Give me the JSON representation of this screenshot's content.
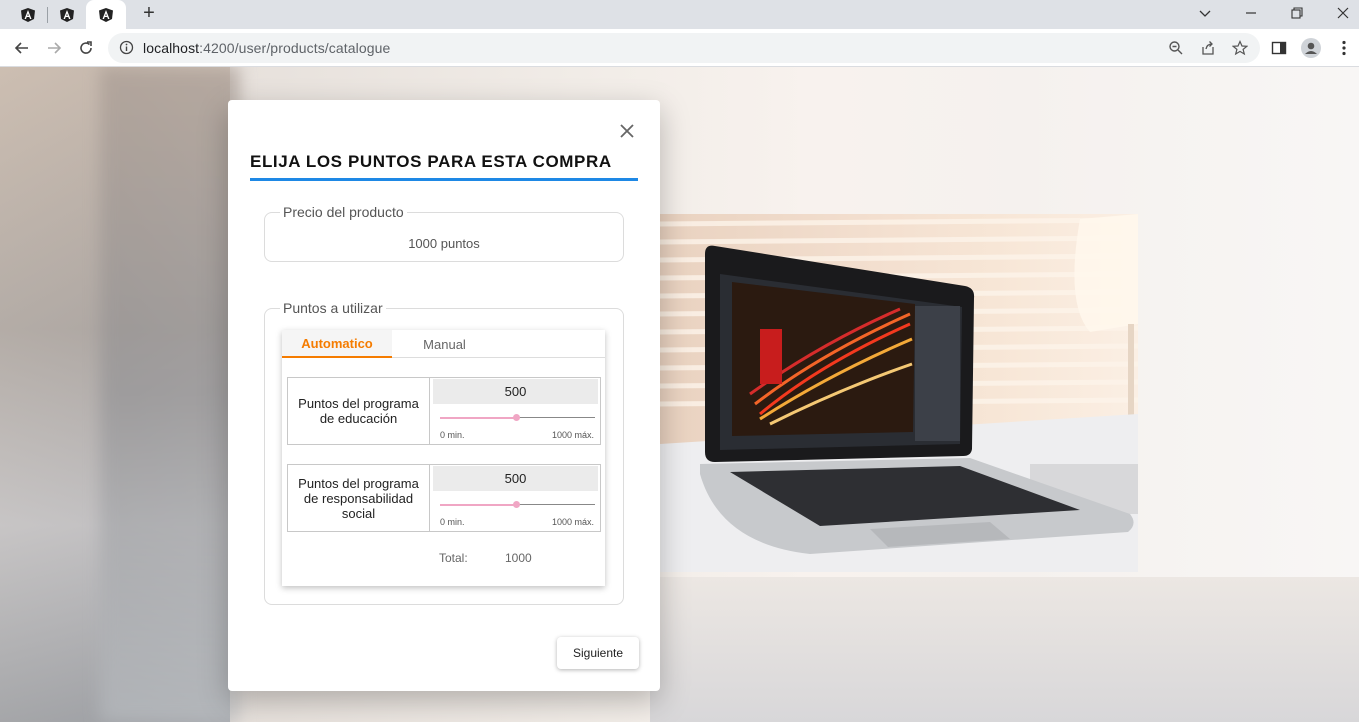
{
  "browser": {
    "tabs": [
      {
        "icon": "angular-icon",
        "active": false
      },
      {
        "icon": "angular-icon",
        "active": false
      },
      {
        "icon": "angular-icon",
        "active": true
      }
    ],
    "new_tab_label": "+",
    "url_host": "localhost",
    "url_path": ":4200/user/products/catalogue"
  },
  "modal": {
    "title": "ELIJA LOS PUNTOS PARA ESTA COMPRA",
    "price_legend": "Precio del producto",
    "price_value": "1000 puntos",
    "points_legend": "Puntos a utilizar",
    "tabs": [
      "Automatico",
      "Manual"
    ],
    "programs": [
      {
        "label": "Puntos del programa de educación",
        "value": "500",
        "min_label": "0 min.",
        "max_label": "1000 máx.",
        "slider_fraction": 0.5
      },
      {
        "label": "Puntos del programa de responsabilidad social",
        "value": "500",
        "min_label": "0 min.",
        "max_label": "1000 máx.",
        "slider_fraction": 0.5
      }
    ],
    "total_label": "Total:",
    "total_value": "1000",
    "next_label": "Siguiente"
  },
  "colors": {
    "accent_blue": "#1e88e5",
    "tab_active_orange": "#f57c00",
    "slider_pink": "#f0a6c4"
  }
}
